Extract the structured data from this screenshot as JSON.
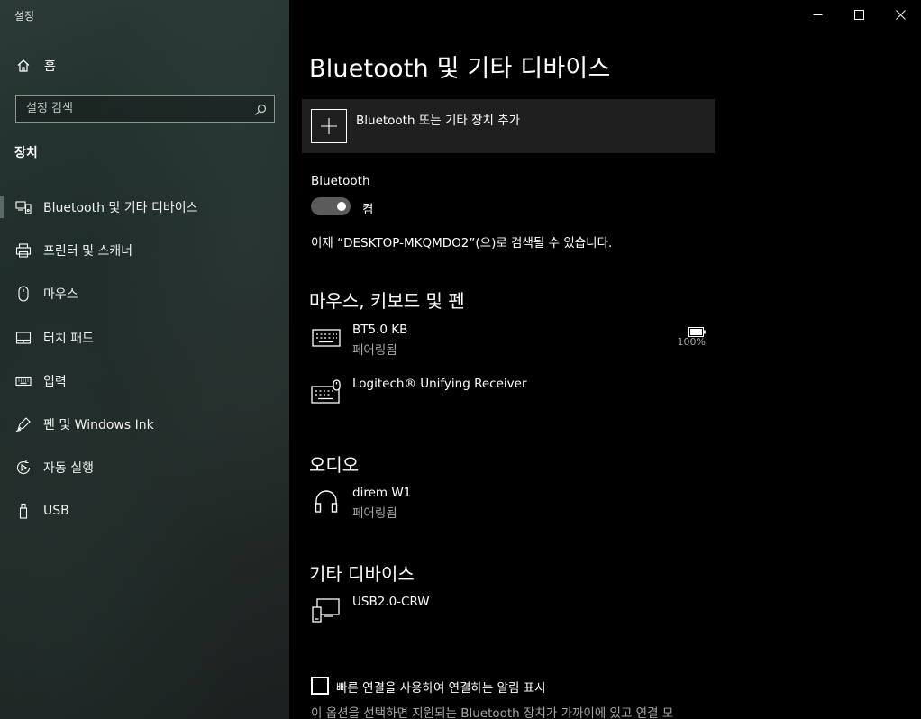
{
  "app": {
    "title": "설정"
  },
  "sidebar": {
    "home_label": "홈",
    "search_placeholder": "설정 검색",
    "section_title": "장치",
    "items": [
      {
        "label": "Bluetooth 및 기타 디바이스",
        "icon": "devices-icon",
        "active": true
      },
      {
        "label": "프린터 및 스캐너",
        "icon": "printer-icon"
      },
      {
        "label": "마우스",
        "icon": "mouse-icon"
      },
      {
        "label": "터치 패드",
        "icon": "touchpad-icon"
      },
      {
        "label": "입력",
        "icon": "keyboard-icon"
      },
      {
        "label": "펜 및 Windows Ink",
        "icon": "pen-icon"
      },
      {
        "label": "자동 실행",
        "icon": "autoplay-icon"
      },
      {
        "label": "USB",
        "icon": "usb-icon"
      }
    ]
  },
  "main": {
    "title": "Bluetooth 및 기타 디바이스",
    "add_device_label": "Bluetooth 또는 기타 장치 추가",
    "bluetooth_label": "Bluetooth",
    "bluetooth_state": "켬",
    "discoverable_text": "이제 “DESKTOP-MKQMDO2”(으)로 검색될 수 있습니다.",
    "groups": {
      "input": {
        "title": "마우스, 키보드 및 펜",
        "devices": [
          {
            "name": "BT5.0 KB",
            "status": "페어링됨",
            "battery": "100%"
          },
          {
            "name": "Logitech® Unifying Receiver"
          }
        ]
      },
      "audio": {
        "title": "오디오",
        "devices": [
          {
            "name": "direm W1",
            "status": "페어링됨"
          }
        ]
      },
      "other": {
        "title": "기타 디바이스",
        "devices": [
          {
            "name": "USB2.0-CRW"
          }
        ]
      }
    },
    "swift_pair_label": "빠른 연결을 사용하여 연결하는 알림 표시",
    "swift_pair_desc": "이 옵션을 선택하면 지원되는 Bluetooth 장치가 가까이에 있고 연결 모"
  },
  "colors": {
    "accent_toggle": "#5b5b5b",
    "sidebar_bg": "#232b29",
    "main_bg": "#000000"
  }
}
